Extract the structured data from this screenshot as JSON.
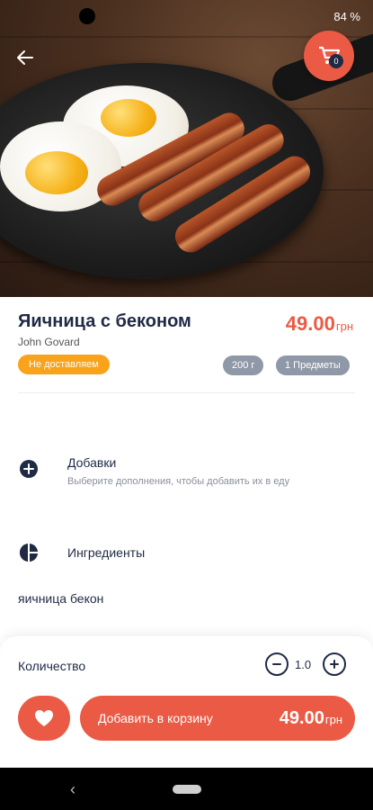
{
  "status_bar": {
    "battery": "84 %"
  },
  "cart": {
    "count": "0"
  },
  "product": {
    "title": "Яичница с беконом",
    "author": "John Govard",
    "price": "49.00",
    "currency": "грн",
    "delivery_badge": "Не доставляем",
    "weight": "200 г",
    "items": "1 Предметы"
  },
  "addons": {
    "title": "Добавки",
    "subtitle": "Выберите дополнения, чтобы добавить их в еду"
  },
  "ingredients": {
    "title": "Ингредиенты",
    "text": "яичница бекон"
  },
  "quantity": {
    "label": "Количество",
    "value": "1.0"
  },
  "add_to_cart": {
    "label": "Добавить в корзину",
    "price": "49.00",
    "currency": "грн"
  },
  "colors": {
    "accent": "#ea5a44",
    "badge_orange": "#f8a31b",
    "pill_gray": "#8f98a7",
    "text_dark": "#1f2a44"
  },
  "icons": [
    "back-arrow-icon",
    "cart-icon",
    "plus-circle-icon",
    "pie-chart-icon",
    "minus-icon",
    "plus-icon",
    "heart-icon"
  ]
}
